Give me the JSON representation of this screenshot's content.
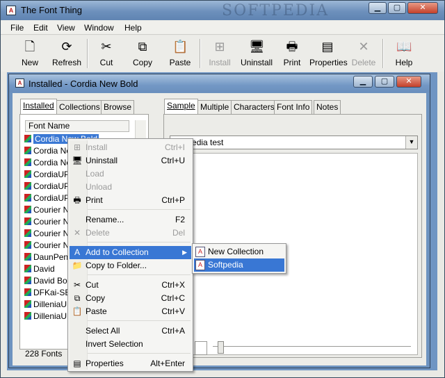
{
  "window": {
    "title": "The Font Thing",
    "watermark": "SOFTPEDIA"
  },
  "menubar": [
    "File",
    "Edit",
    "View",
    "Window",
    "Help"
  ],
  "toolbar": [
    {
      "label": "New",
      "icon": "new-icon",
      "enabled": true
    },
    {
      "label": "Refresh",
      "icon": "refresh-icon",
      "enabled": true
    },
    {
      "label": "Cut",
      "icon": "scissors-icon",
      "enabled": true
    },
    {
      "label": "Copy",
      "icon": "copy-icon",
      "enabled": true
    },
    {
      "label": "Paste",
      "icon": "paste-icon",
      "enabled": true
    },
    {
      "label": "Install",
      "icon": "install-icon",
      "enabled": false
    },
    {
      "label": "Uninstall",
      "icon": "uninstall-icon",
      "enabled": true
    },
    {
      "label": "Print",
      "icon": "printer-icon",
      "enabled": true
    },
    {
      "label": "Properties",
      "icon": "properties-icon",
      "enabled": true
    },
    {
      "label": "Delete",
      "icon": "delete-icon",
      "enabled": false
    },
    {
      "label": "Help",
      "icon": "help-book-icon",
      "enabled": true
    }
  ],
  "child": {
    "title": "Installed - Cordia New Bold",
    "left_tabs": [
      "Installed",
      "Collections",
      "Browse"
    ],
    "right_tabs": [
      "Sample",
      "Multiple",
      "Characters",
      "Font Info",
      "Notes"
    ],
    "list_header": "Font Name",
    "fonts": [
      "Cordia New Bold",
      "Cordia New",
      "Cordia New",
      "CordiaUPC",
      "CordiaUPC",
      "CordiaUPC",
      "Courier Ne",
      "Courier Ne",
      "Courier Ne",
      "Courier Ne",
      "DaunPenh",
      "David",
      "David Bold",
      "DFKai-SB",
      "DilleniaUP",
      "DilleniaUP"
    ],
    "status": "228 Fonts",
    "sample_text": "Softpedia test"
  },
  "context_menu": [
    {
      "label": "Install",
      "shortcut": "Ctrl+I",
      "enabled": false,
      "icon": "install-icon"
    },
    {
      "label": "Uninstall",
      "shortcut": "Ctrl+U",
      "enabled": true,
      "icon": "uninstall-icon"
    },
    {
      "label": "Load",
      "shortcut": "",
      "enabled": false,
      "icon": ""
    },
    {
      "label": "Unload",
      "shortcut": "",
      "enabled": false,
      "icon": ""
    },
    {
      "label": "Print",
      "shortcut": "Ctrl+P",
      "enabled": true,
      "icon": "printer-icon"
    },
    {
      "label": "Rename...",
      "shortcut": "F2",
      "enabled": true,
      "icon": ""
    },
    {
      "label": "Delete",
      "shortcut": "Del",
      "enabled": false,
      "icon": "delete-icon"
    },
    {
      "label": "Add to Collection",
      "shortcut": "",
      "enabled": true,
      "icon": "collection-icon",
      "submenu": true
    },
    {
      "label": "Copy to Folder...",
      "shortcut": "",
      "enabled": true,
      "icon": "folder-icon"
    },
    {
      "label": "Cut",
      "shortcut": "Ctrl+X",
      "enabled": true,
      "icon": "scissors-icon"
    },
    {
      "label": "Copy",
      "shortcut": "Ctrl+C",
      "enabled": true,
      "icon": "copy-icon"
    },
    {
      "label": "Paste",
      "shortcut": "Ctrl+V",
      "enabled": true,
      "icon": "paste-icon"
    },
    {
      "label": "Select All",
      "shortcut": "Ctrl+A",
      "enabled": true,
      "icon": ""
    },
    {
      "label": "Invert Selection",
      "shortcut": "",
      "enabled": true,
      "icon": ""
    },
    {
      "label": "Properties",
      "shortcut": "Alt+Enter",
      "enabled": true,
      "icon": "properties-icon"
    }
  ],
  "submenu": [
    "New Collection",
    "Softpedia"
  ],
  "colors": {
    "selection": "#3977d4",
    "title_gradient_top": "#9cb7d6",
    "mdi_background": "#6f95c3"
  }
}
